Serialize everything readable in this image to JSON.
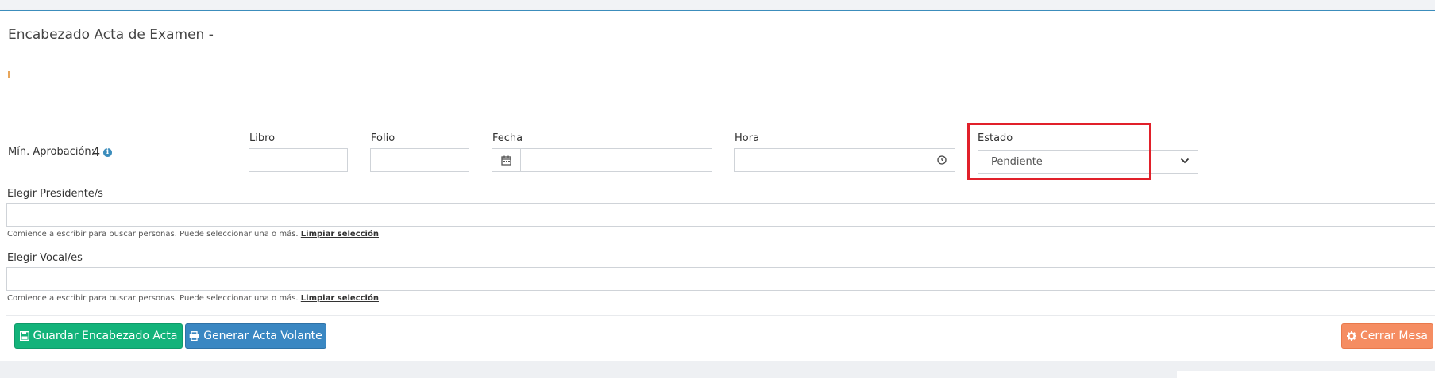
{
  "header": {
    "title": "Encabezado Acta de Examen -"
  },
  "min_aprobacion": {
    "label": "Mín. Aprobación:",
    "value": "4"
  },
  "fields": {
    "libro": {
      "label": "Libro",
      "value": ""
    },
    "folio": {
      "label": "Folio",
      "value": ""
    },
    "fecha": {
      "label": "Fecha",
      "value": ""
    },
    "hora": {
      "label": "Hora",
      "value": ""
    },
    "estado": {
      "label": "Estado",
      "selected": "Pendiente"
    }
  },
  "presidentes": {
    "label": "Elegir Presidente/s",
    "help": "Comience a escribir para buscar personas. Puede seleccionar una o más.",
    "clear_link": "Limpiar selección"
  },
  "vocales": {
    "label": "Elegir Vocal/es",
    "help": "Comience a escribir para buscar personas. Puede seleccionar una o más.",
    "clear_link": "Limpiar selección"
  },
  "buttons": {
    "save": "Guardar Encabezado Acta",
    "generate": "Generar Acta Volante",
    "close": "Cerrar Mesa"
  },
  "icons": {
    "info": "info-icon",
    "calendar": "calendar-icon",
    "clock": "clock-icon",
    "chevron": "chevron-down-icon",
    "save": "floppy-disk-icon",
    "print": "printer-icon",
    "gear": "gear-icon"
  },
  "colors": {
    "accent_border": "#3c8dbc",
    "save_button": "#13b37a",
    "generate_button": "#3a87c2",
    "close_button": "#f58d62",
    "highlight": "#e1202a"
  }
}
